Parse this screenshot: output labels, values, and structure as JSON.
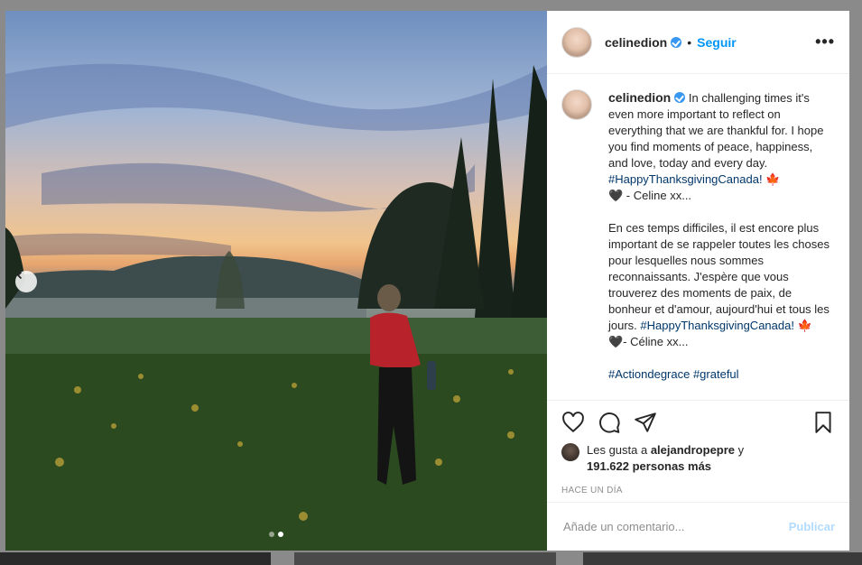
{
  "post": {
    "username": "celinedion",
    "follow_label": "Seguir",
    "separator": "•",
    "more_label": "•••"
  },
  "caption": {
    "username": "celinedion",
    "p1_a": "In challenging times it's even more important to reflect on everything that we are thankful for.  I hope you find moments of peace, happiness, and love, today and every day. ",
    "p1_tag": "#HappyThanksgivingCanada!",
    "p1_emoji": " 🍁",
    "p1_b": "🖤 - Celine xx...",
    "p2_a": "En ces temps difficiles, il est encore plus important de se rappeler toutes les choses pour lesquelles nous sommes reconnaissants. J'espère que vous trouverez des moments de paix, de bonheur et d'amour, aujourd'hui et tous les jours. ",
    "p2_tag": "#HappyThanksgivingCanada!",
    "p2_b": " 🍁🖤- Céline xx...",
    "p3_tags": "#Actiondegrace #grateful"
  },
  "likes": {
    "prefix": "Les gusta a ",
    "user": "alejandropepre",
    "suffix": " y",
    "count": "191.622 personas más"
  },
  "timestamp": "HACE UN DÍA",
  "comment": {
    "placeholder": "Añade un comentario...",
    "publish_label": "Publicar"
  },
  "carousel": {
    "current": 2,
    "total": 2
  },
  "icons": [
    "heart-icon",
    "comment-icon",
    "share-icon",
    "bookmark-icon",
    "chevron-left-icon",
    "verified-icon"
  ],
  "colors": {
    "link": "#0095f6",
    "hashtag": "#00376b",
    "verified": "#3897f0",
    "publish_disabled": "#b3dbff"
  }
}
